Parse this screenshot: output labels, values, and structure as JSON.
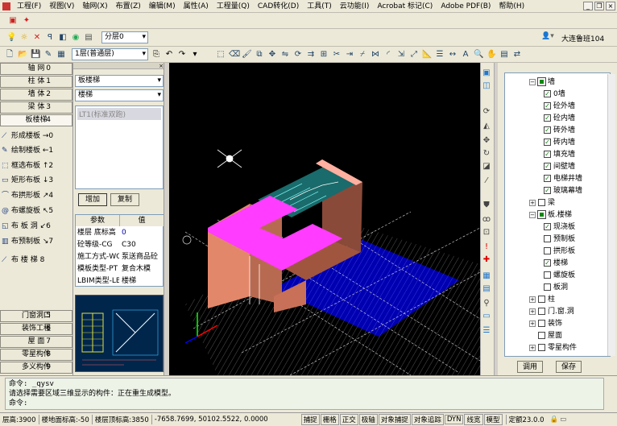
{
  "menus": [
    "工程(F)",
    "视图(V)",
    "轴网(X)",
    "布置(Z)",
    "编辑(M)",
    "属性(A)",
    "工程量(Q)",
    "CAD转化(D)",
    "工具(T)",
    "云功能(I)",
    "Acrobat 标记(C)",
    "Adobe PDF(B)",
    "帮助(H)"
  ],
  "toolbar": {
    "layer_select": "分层0",
    "floor_select": "1层(普通层)",
    "user": "大连鲁班104"
  },
  "nav_top": [
    {
      "label": "轴  网",
      "num": "0"
    },
    {
      "label": "柱  体",
      "num": "1"
    },
    {
      "label": "墙  体",
      "num": "2"
    },
    {
      "label": "梁  体",
      "num": "3"
    },
    {
      "label": "板楼梯",
      "num": "4"
    }
  ],
  "tools": [
    {
      "label": "形成楼板",
      "key": "→0"
    },
    {
      "label": "绘制楼板",
      "key": "←1"
    },
    {
      "label": "框选布板",
      "key": "↑2"
    },
    {
      "label": "矩形布板",
      "key": "↓3"
    },
    {
      "label": "布拱形板",
      "key": "↗4"
    },
    {
      "label": "布螺旋板",
      "key": "↖5"
    },
    {
      "label": "布  板  洞",
      "key": "↙6"
    },
    {
      "label": "布预制板",
      "key": "↘7"
    },
    {
      "label": "布  楼  梯",
      "key": "8"
    }
  ],
  "nav_bottom": [
    {
      "label": "门窗洞口",
      "num": "5"
    },
    {
      "label": "装饰工程",
      "num": "6"
    },
    {
      "label": "屋  面",
      "num": "7"
    },
    {
      "label": "零星构件",
      "num": "8"
    },
    {
      "label": "多义构件",
      "num": "9"
    }
  ],
  "props": {
    "category": "板楼梯",
    "type": "楼梯",
    "list_item": "LT1(标准双跑)",
    "add_button": "增加",
    "copy_button": "复制",
    "header_param": "参数",
    "header_value": "值",
    "rows": [
      {
        "k": "楼层 底标高",
        "v": "0"
      },
      {
        "k": "砼等级-CG",
        "v": "C30"
      },
      {
        "k": "施工方式-WO",
        "v": "泵送商品砼"
      },
      {
        "k": "模板类型-PT",
        "v": "复合木模"
      },
      {
        "k": "LBIM类型-LB",
        "v": "楼梯"
      }
    ]
  },
  "tree": [
    {
      "label": "墙",
      "level": 1,
      "state": "partial",
      "toggle": "−"
    },
    {
      "label": "0墙",
      "level": 2,
      "state": "checked"
    },
    {
      "label": "砼外墙",
      "level": 2,
      "state": "checked"
    },
    {
      "label": "砼内墙",
      "level": 2,
      "state": "checked"
    },
    {
      "label": "砖外墙",
      "level": 2,
      "state": "checked"
    },
    {
      "label": "砖内墙",
      "level": 2,
      "state": "checked"
    },
    {
      "label": "填充墙",
      "level": 2,
      "state": "checked"
    },
    {
      "label": "间壁墙",
      "level": 2,
      "state": "checked"
    },
    {
      "label": "电梯井墙",
      "level": 2,
      "state": "checked"
    },
    {
      "label": "玻璃幕墙",
      "level": 2,
      "state": "checked"
    },
    {
      "label": "梁",
      "level": 1,
      "state": "empty",
      "toggle": "+"
    },
    {
      "label": "板.楼梯",
      "level": 1,
      "state": "partial",
      "toggle": "−"
    },
    {
      "label": "现浇板",
      "level": 2,
      "state": "checked"
    },
    {
      "label": "预制板",
      "level": 2,
      "state": "empty"
    },
    {
      "label": "拱形板",
      "level": 2,
      "state": "empty"
    },
    {
      "label": "楼梯",
      "level": 2,
      "state": "checked"
    },
    {
      "label": "螺旋板",
      "level": 2,
      "state": "empty"
    },
    {
      "label": "板洞",
      "level": 2,
      "state": "empty"
    },
    {
      "label": "柱",
      "level": 1,
      "state": "empty",
      "toggle": "+"
    },
    {
      "label": "门.窗.洞",
      "level": 1,
      "state": "empty",
      "toggle": "+"
    },
    {
      "label": "装饰",
      "level": 1,
      "state": "empty",
      "toggle": "+"
    },
    {
      "label": "屋面",
      "level": 1,
      "state": "empty",
      "toggle": ""
    },
    {
      "label": "零星构件",
      "level": 1,
      "state": "empty",
      "toggle": "+"
    }
  ],
  "tree_buttons": {
    "apply": "调用",
    "save": "保存"
  },
  "command": {
    "line1": "命令: _qysv",
    "line2": "请选择需要区域三维显示的构件：正在重生成模型。",
    "line3": "命令:"
  },
  "status": {
    "floor_h": "层高:3900",
    "floor_bottom": "楼地面标高:-50",
    "floor_top": "楼层顶标高:3850",
    "coords": "-7658.7699, 50102.5522, 0.0000",
    "toggles": [
      "捕捉",
      "栅格",
      "正交",
      "极轴",
      "对象捕捉",
      "对象追踪",
      "DYN",
      "线宽",
      "模型"
    ],
    "snap": "定额23.0.0"
  },
  "colors": {
    "viewport_bg": "#000000",
    "slab": "#ff3cff",
    "wall": "#e3876a",
    "grid": "#ffffff",
    "floor_blue": "#0000b0"
  }
}
